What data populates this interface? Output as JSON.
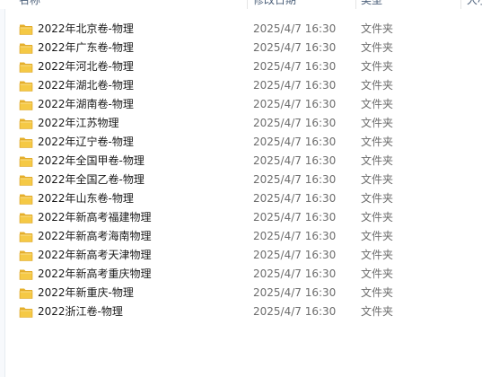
{
  "columns": {
    "name": "名称",
    "modified": "修改日期",
    "type": "类型",
    "size": "大小"
  },
  "icon": "folder-icon",
  "colors": {
    "folder_body": "#f5c945",
    "folder_tab": "#e6b02d",
    "folder_edge": "#d9a01e"
  },
  "files": [
    {
      "name": "2022年北京卷-物理",
      "modified": "2025/4/7 16:30",
      "type": "文件夹"
    },
    {
      "name": "2022年广东卷-物理",
      "modified": "2025/4/7 16:30",
      "type": "文件夹"
    },
    {
      "name": "2022年河北卷-物理",
      "modified": "2025/4/7 16:30",
      "type": "文件夹"
    },
    {
      "name": "2022年湖北卷-物理",
      "modified": "2025/4/7 16:30",
      "type": "文件夹"
    },
    {
      "name": "2022年湖南卷-物理",
      "modified": "2025/4/7 16:30",
      "type": "文件夹"
    },
    {
      "name": "2022年江苏物理",
      "modified": "2025/4/7 16:30",
      "type": "文件夹"
    },
    {
      "name": "2022年辽宁卷-物理",
      "modified": "2025/4/7 16:30",
      "type": "文件夹"
    },
    {
      "name": "2022年全国甲卷-物理",
      "modified": "2025/4/7 16:30",
      "type": "文件夹"
    },
    {
      "name": "2022年全国乙卷-物理",
      "modified": "2025/4/7 16:30",
      "type": "文件夹"
    },
    {
      "name": "2022年山东卷-物理",
      "modified": "2025/4/7 16:30",
      "type": "文件夹"
    },
    {
      "name": "2022年新高考福建物理",
      "modified": "2025/4/7 16:30",
      "type": "文件夹"
    },
    {
      "name": "2022年新高考海南物理",
      "modified": "2025/4/7 16:30",
      "type": "文件夹"
    },
    {
      "name": "2022年新高考天津物理",
      "modified": "2025/4/7 16:30",
      "type": "文件夹"
    },
    {
      "name": "2022年新高考重庆物理",
      "modified": "2025/4/7 16:30",
      "type": "文件夹"
    },
    {
      "name": "2022年新重庆-物理",
      "modified": "2025/4/7 16:30",
      "type": "文件夹"
    },
    {
      "name": "2022浙江卷-物理",
      "modified": "2025/4/7 16:30",
      "type": "文件夹"
    }
  ]
}
